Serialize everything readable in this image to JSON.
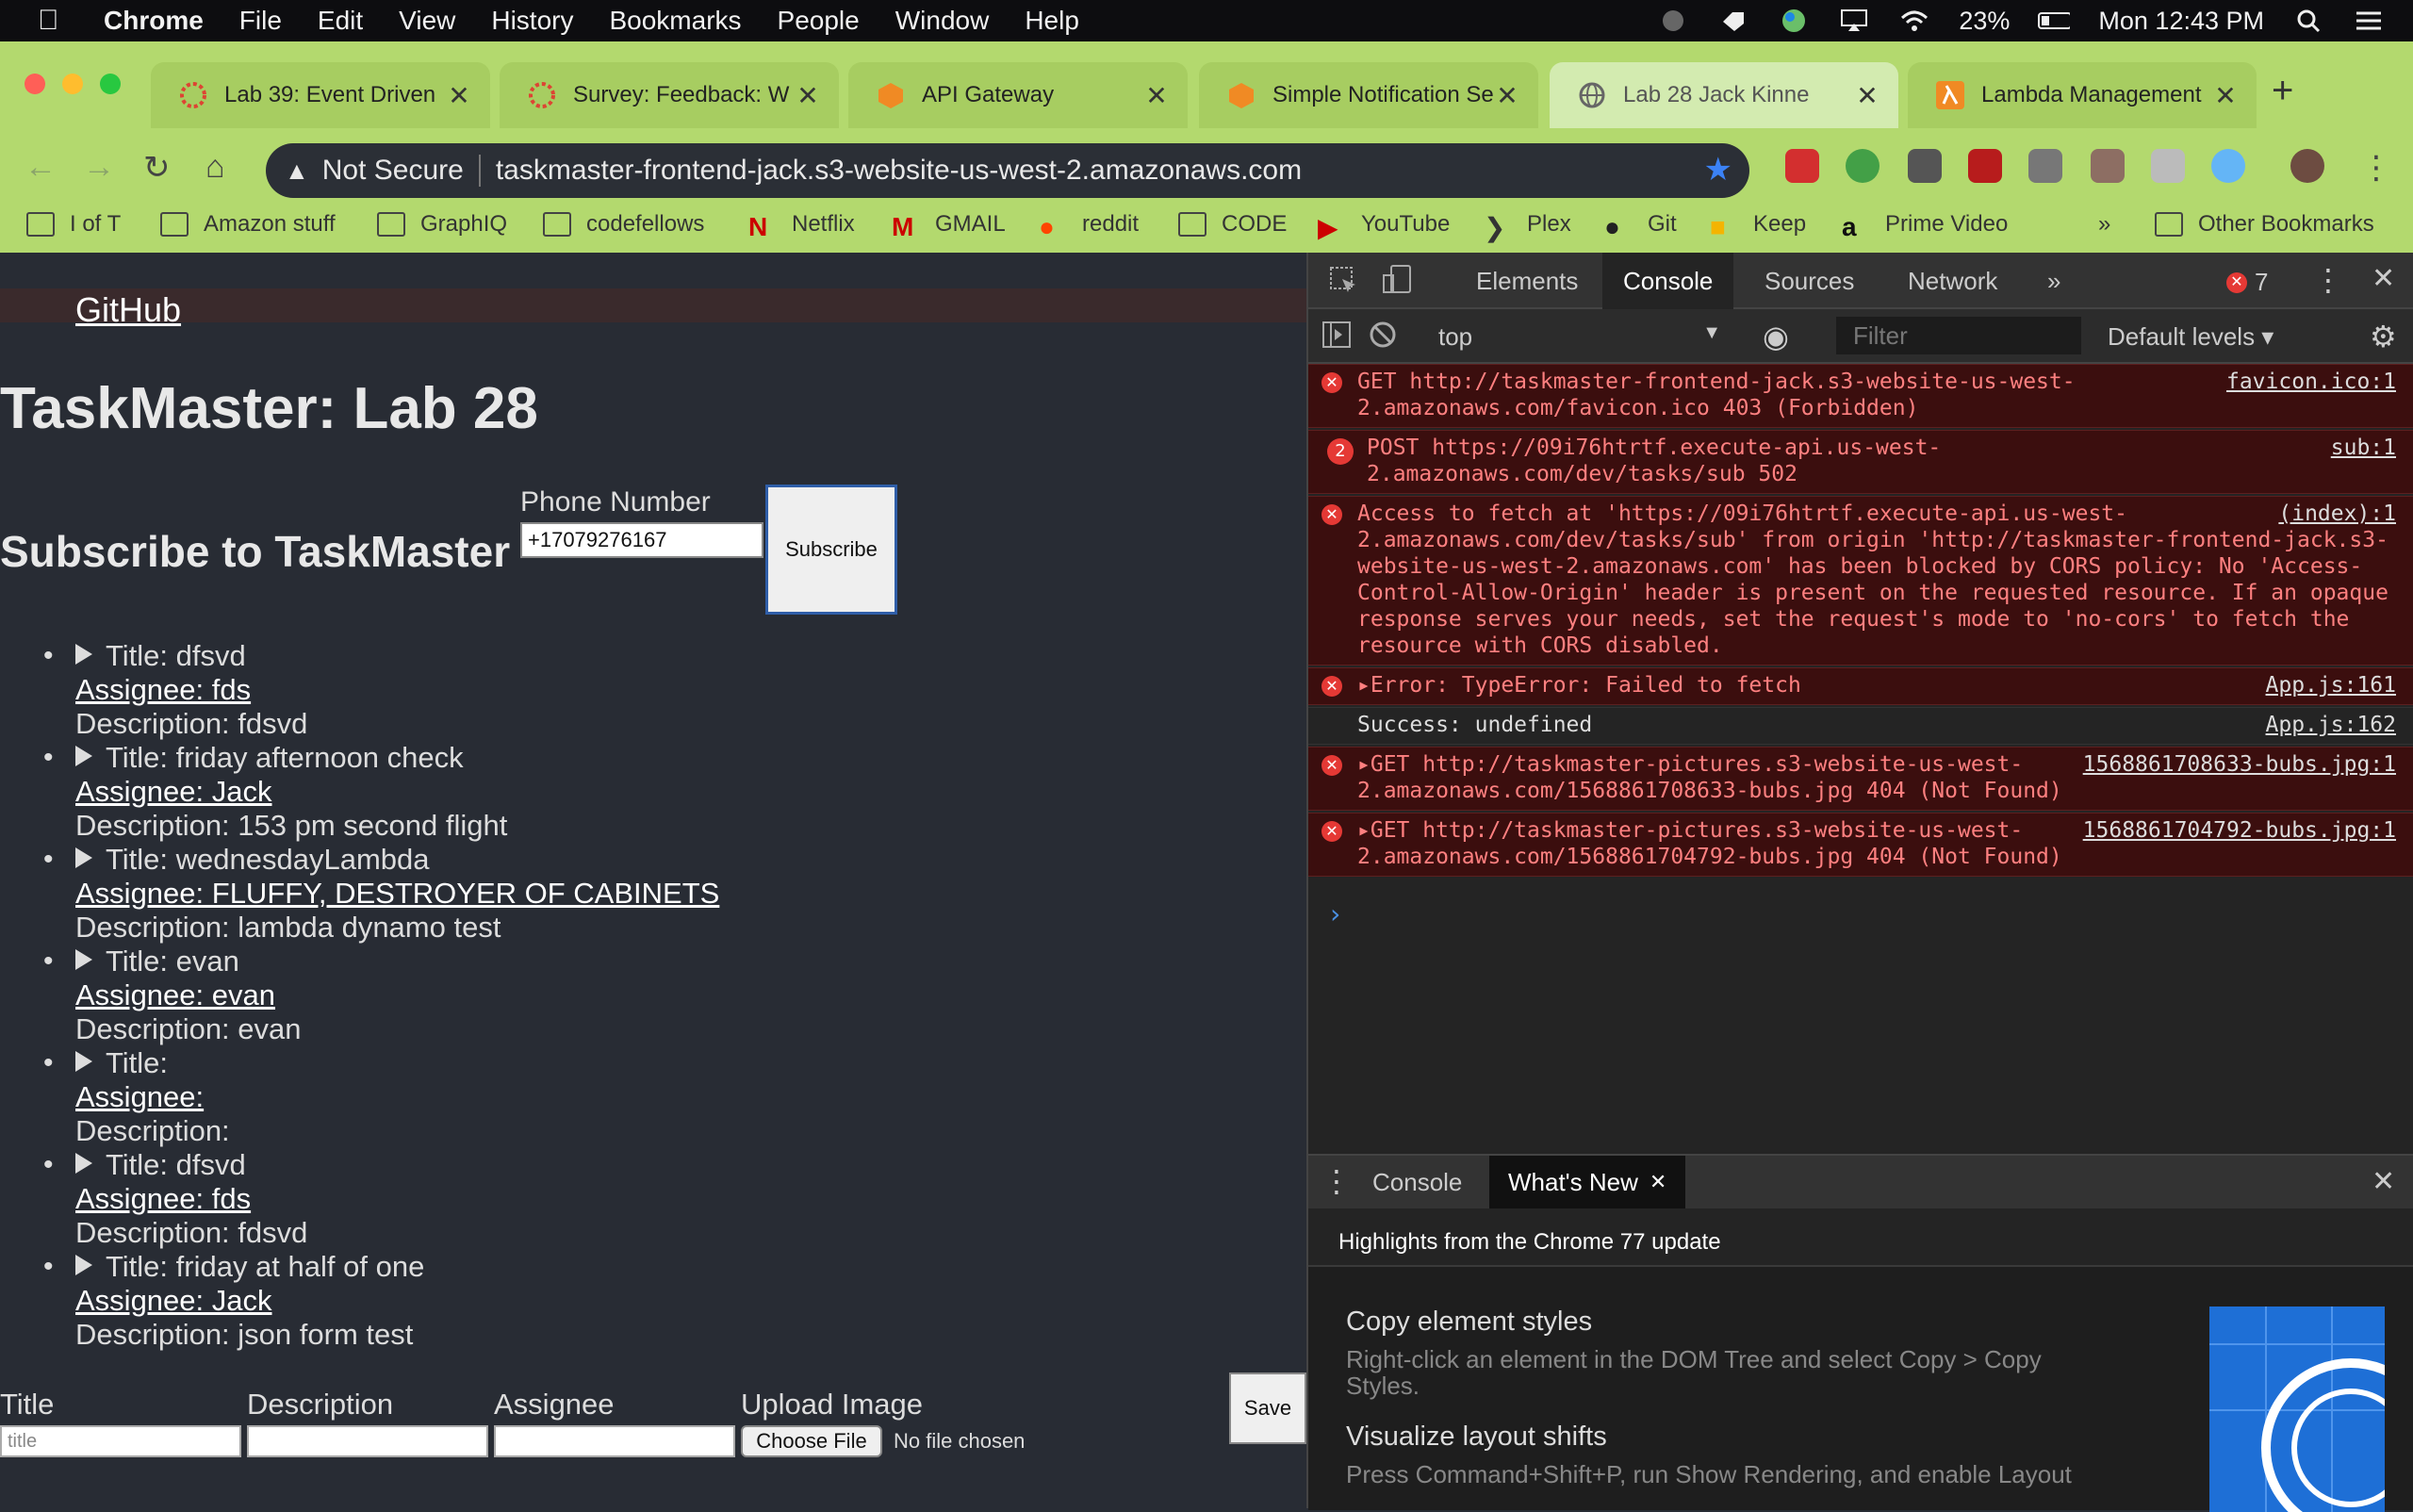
{
  "menubar": {
    "app": "Chrome",
    "items": [
      "File",
      "Edit",
      "View",
      "History",
      "Bookmarks",
      "People",
      "Window",
      "Help"
    ],
    "battery": "23%",
    "clock": "Mon 12:43 PM"
  },
  "tabs": [
    {
      "title": "Lab 39: Event Driven",
      "icon": "canvas-icon"
    },
    {
      "title": "Survey: Feedback: W",
      "icon": "canvas-icon"
    },
    {
      "title": "API Gateway",
      "icon": "aws-icon"
    },
    {
      "title": "Simple Notification Se",
      "icon": "aws-icon"
    },
    {
      "title": "Lab 28 Jack Kinne",
      "icon": "globe-icon"
    },
    {
      "title": "Lambda Management",
      "icon": "lambda-icon"
    }
  ],
  "omnibox": {
    "security": "Not Secure",
    "url": "taskmaster-frontend-jack.s3-website-us-west-2.amazonaws.com"
  },
  "bookmarks": [
    "I of T",
    "Amazon stuff",
    "GraphIQ",
    "codefellows",
    "Netflix",
    "GMAIL",
    "reddit",
    "CODE",
    "YouTube",
    "Plex",
    "Git",
    "Keep",
    "Prime Video",
    "»",
    "Other Bookmarks"
  ],
  "page": {
    "github": "GitHub",
    "title": "TaskMaster: Lab 28",
    "subscribe_heading": "Subscribe to TaskMaster",
    "phone_label": "Phone Number",
    "phone_value": "+17079276167",
    "subscribe_button": "Subscribe",
    "tasks": [
      {
        "title": "Title: dfsvd",
        "assignee": "Assignee: fds",
        "desc": "Description: fdsvd"
      },
      {
        "title": "Title: friday afternoon check",
        "assignee": "Assignee: Jack",
        "desc": "Description: 153 pm second flight"
      },
      {
        "title": "Title: wednesdayLambda",
        "assignee": "Assignee: FLUFFY, DESTROYER OF CABINETS",
        "desc": "Description: lambda dynamo test"
      },
      {
        "title": "Title: evan",
        "assignee": "Assignee: evan",
        "desc": "Description: evan"
      },
      {
        "title": "Title:",
        "assignee": "Assignee:",
        "desc": "Description:"
      },
      {
        "title": "Title: dfsvd",
        "assignee": "Assignee: fds",
        "desc": "Description: fdsvd"
      },
      {
        "title": "Title: friday at half of one",
        "assignee": "Assignee: Jack",
        "desc": "Description: json form test"
      }
    ],
    "form": {
      "title_label": "Title",
      "title_placeholder": "title",
      "desc_label": "Description",
      "assignee_label": "Assignee",
      "upload_label": "Upload Image",
      "choose_file": "Choose File",
      "no_file": "No file chosen",
      "save": "Save"
    }
  },
  "devtools": {
    "tabs": [
      "Elements",
      "Console",
      "Sources",
      "Network",
      "»"
    ],
    "error_count": "7",
    "context": "top",
    "filter_placeholder": "Filter",
    "levels": "Default levels",
    "messages": [
      {
        "count": "",
        "text": "GET http://taskmaster-frontend-jack.s3-website-us-west-2.amazonaws.com/favicon.ico 403 (Forbidden)",
        "source": "favicon.ico:1"
      },
      {
        "count": "2",
        "text": "POST https://09i76htrtf.execute-api.us-west-2.amazonaws.com/dev/tasks/sub 502",
        "source": "sub:1"
      },
      {
        "count": "",
        "text": "Access to fetch at 'https://09i76htrtf.execute-api.us-west-2.amazonaws.com/dev/tasks/sub' from origin 'http://taskmaster-frontend-jack.s3-website-us-west-2.amazonaws.com' has been blocked by CORS policy: No 'Access-Control-Allow-Origin' header is present on the requested resource. If an opaque response serves your needs, set the request's mode to 'no-cors' to fetch the resource with CORS disabled.",
        "source": "(index):1"
      },
      {
        "count": "",
        "text": "▸Error: TypeError: Failed to fetch",
        "source": "App.js:161"
      },
      {
        "count": "",
        "text": "Success: undefined",
        "source": "App.js:162"
      },
      {
        "count": "",
        "text": "▸GET http://taskmaster-pictures.s3-website-us-west-2.amazonaws.com/1568861708633-bubs.jpg 404 (Not Found)",
        "source": "1568861708633-bubs.jpg:1"
      },
      {
        "count": "",
        "text": "▸GET http://taskmaster-pictures.s3-website-us-west-2.amazonaws.com/1568861704792-bubs.jpg 404 (Not Found)",
        "source": "1568861704792-bubs.jpg:1"
      }
    ],
    "drawer": {
      "tabs": [
        "Console",
        "What's New"
      ],
      "highlights": "Highlights from the Chrome 77 update",
      "features": [
        {
          "title": "Copy element styles",
          "desc": "Right-click an element in the DOM Tree and select Copy > Copy Styles."
        },
        {
          "title": "Visualize layout shifts",
          "desc": "Press Command+Shift+P, run Show Rendering, and enable Layout Shift Regions to visualize content shifts."
        }
      ]
    }
  }
}
